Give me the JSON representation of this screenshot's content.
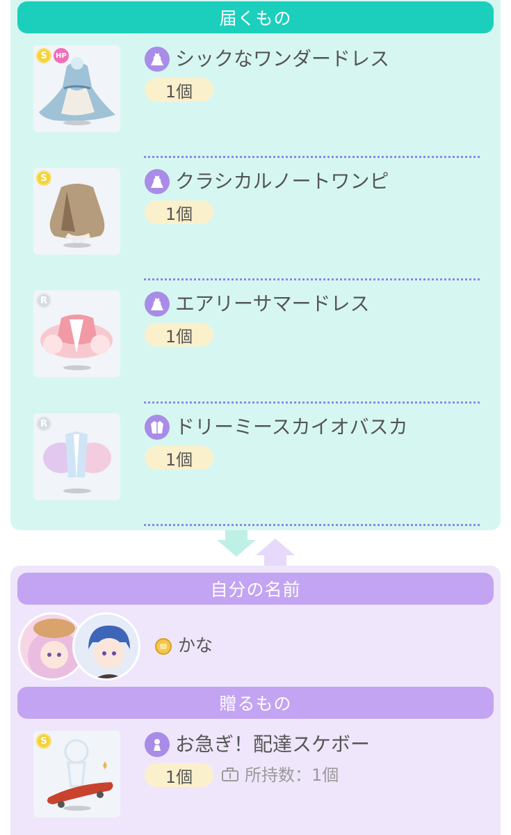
{
  "receive": {
    "header": "届くもの",
    "items": [
      {
        "name": "シックなワンダードレス",
        "qty": "1個",
        "rank": "S",
        "extra_badge": "HP",
        "category_icon": "dress-icon"
      },
      {
        "name": "クラシカルノートワンピ",
        "qty": "1個",
        "rank": "S",
        "category_icon": "dress-icon"
      },
      {
        "name": "エアリーサマードレス",
        "qty": "1個",
        "rank": "R",
        "category_icon": "dress-icon"
      },
      {
        "name": "ドリーミースカイオバスカ",
        "qty": "1個",
        "rank": "R",
        "category_icon": "coat-icon"
      }
    ]
  },
  "self": {
    "header": "自分の名前",
    "user_name": "かな"
  },
  "give": {
    "header": "贈るもの",
    "item": {
      "name": "お急ぎ！配達スケボー",
      "qty": "1個",
      "rank": "S",
      "category_icon": "accessory-icon"
    },
    "owned_label": "所持数：1個"
  },
  "colors": {
    "teal_header": "#1ccfbd",
    "teal_panel": "#d6f7f1",
    "purple_header": "#c2a4f2",
    "purple_panel": "#efe6fb",
    "qty_pill": "#fbf0cc",
    "category_icon": "#a98be8"
  }
}
